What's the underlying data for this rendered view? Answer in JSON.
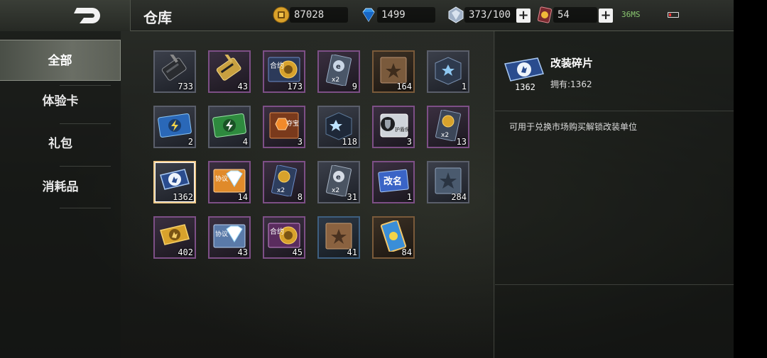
{
  "header": {
    "title": "仓库",
    "gold": "87028",
    "diamonds": "1499",
    "energy": "373/100",
    "cards": "54",
    "ping": "36MS"
  },
  "sidebar": {
    "items": [
      {
        "label": "全部",
        "active": true
      },
      {
        "label": "体验卡"
      },
      {
        "label": "礼包"
      },
      {
        "label": "消耗品"
      }
    ]
  },
  "inventory": {
    "items": [
      {
        "name": "walkie-talkie-icon",
        "count": "733"
      },
      {
        "name": "gold-walkie-talkie-icon",
        "count": "43"
      },
      {
        "name": "contract-coin-icon",
        "count": "173"
      },
      {
        "name": "exp-card-x2-icon",
        "count": "9"
      },
      {
        "name": "star-book-icon",
        "count": "164"
      },
      {
        "name": "supply-crate-icon",
        "count": "1"
      },
      {
        "name": "blue-lightning-ticket-icon",
        "count": "2"
      },
      {
        "name": "green-lightning-ticket-icon",
        "count": "4"
      },
      {
        "name": "treasure-ticket-icon",
        "count": "3"
      },
      {
        "name": "star-crate-icon",
        "count": "118"
      },
      {
        "name": "shield-card-icon",
        "count": "3"
      },
      {
        "name": "coin-card-x2-icon",
        "count": "13"
      },
      {
        "name": "mod-fragment-icon",
        "count": "1362"
      },
      {
        "name": "protocol-diamond-icon",
        "count": "14"
      },
      {
        "name": "coin-card-x2-blue-icon",
        "count": "8"
      },
      {
        "name": "exp-card-x2-silver-icon",
        "count": "31"
      },
      {
        "name": "rename-card-icon",
        "count": "1"
      },
      {
        "name": "star-plate-icon",
        "count": "284"
      },
      {
        "name": "gold-wings-ticket-icon",
        "count": "402"
      },
      {
        "name": "protocol-diamond-blue-icon",
        "count": "43"
      },
      {
        "name": "contract-coin-purple-icon",
        "count": "45"
      },
      {
        "name": "star-book-brown-icon",
        "count": "41"
      },
      {
        "name": "blue-card-icon",
        "count": "84"
      }
    ],
    "item_texts": {
      "contract": "合约",
      "treasure": "夺宝",
      "protocol": "协议",
      "shield": "护盾保护卡",
      "rename": "改名",
      "x2": "x2"
    }
  },
  "detail": {
    "name": "改装碎片",
    "owned": "拥有:1362",
    "count": "1362",
    "description": "可用于兑换市场购买解锁改装单位"
  },
  "colors": {
    "accent_gold": "#f0c98a",
    "purple_border": "#7d4f86",
    "blue_border": "#3e5f80"
  }
}
